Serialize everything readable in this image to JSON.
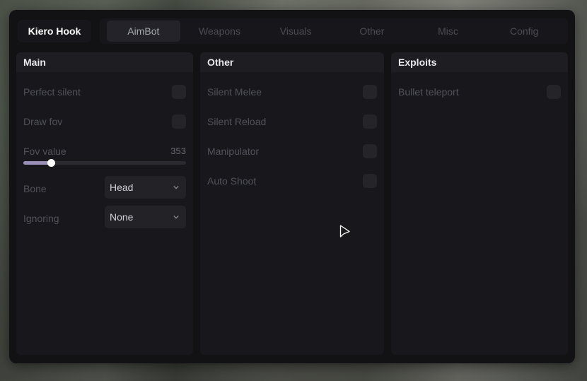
{
  "app": {
    "title": "Kiero Hook"
  },
  "tabs": [
    {
      "label": "AimBot",
      "active": true
    },
    {
      "label": "Weapons",
      "active": false
    },
    {
      "label": "Visuals",
      "active": false
    },
    {
      "label": "Other",
      "active": false
    },
    {
      "label": "Misc",
      "active": false
    },
    {
      "label": "Config",
      "active": false
    }
  ],
  "panels": {
    "main": {
      "title": "Main",
      "perfect_silent": {
        "label": "Perfect silent",
        "enabled": false
      },
      "draw_fov": {
        "label": "Draw fov",
        "enabled": false
      },
      "fov": {
        "label": "Fov value",
        "value": "353",
        "fill_fraction": 0.17
      },
      "bone": {
        "label": "Bone",
        "selected": "Head"
      },
      "ignoring": {
        "label": "Ignoring",
        "selected": "None"
      }
    },
    "other": {
      "title": "Other",
      "items": [
        {
          "label": "Silent Melee",
          "enabled": false
        },
        {
          "label": "Silent Reload",
          "enabled": false
        },
        {
          "label": "Manipulator",
          "enabled": false
        },
        {
          "label": "Auto Shoot",
          "enabled": false
        }
      ]
    },
    "exploits": {
      "title": "Exploits",
      "items": [
        {
          "label": "Bullet teleport",
          "enabled": false
        }
      ]
    }
  },
  "colors": {
    "window_bg": "#121215",
    "panel_bg": "#18181c",
    "accent_fill": "#9a8fb8",
    "active_tab_bg": "#232329"
  },
  "icons": {
    "dropdown": "chevron-down-icon",
    "cursor": "mouse-cursor-icon"
  }
}
